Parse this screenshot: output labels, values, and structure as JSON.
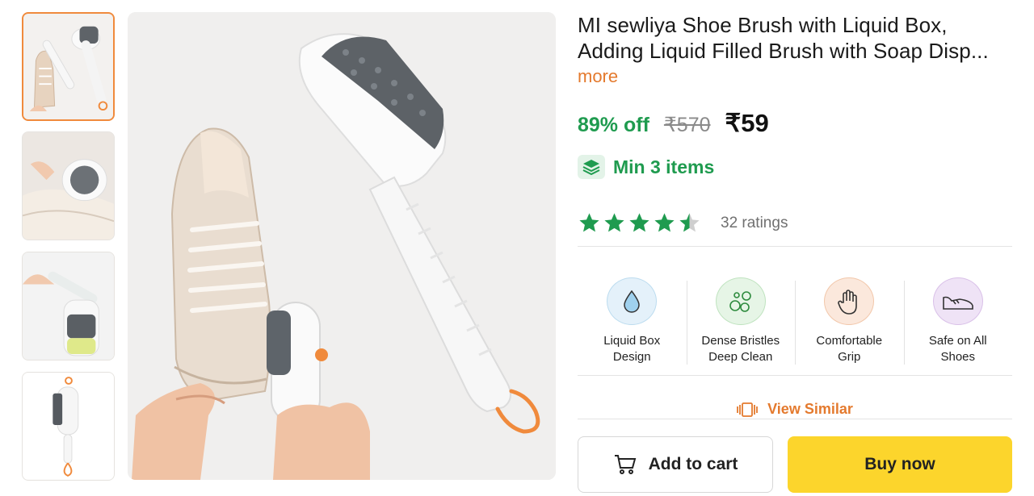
{
  "product": {
    "title_line1": "MI sewliya Shoe Brush with Liquid Box,",
    "title_line2": "Adding Liquid Filled Brush with Soap Disp...",
    "more_label": "more",
    "discount": "89% off",
    "mrp": "₹570",
    "price": "₹59",
    "min_items": "Min 3 items",
    "rating_stars": 4.5,
    "ratings_count": "32 ratings"
  },
  "thumbnails": [
    {
      "name": "thumb-shoe-and-brush",
      "active": true
    },
    {
      "name": "thumb-brush-cleaning-shoe",
      "active": false
    },
    {
      "name": "thumb-filling-liquid",
      "active": false
    },
    {
      "name": "thumb-brush-only",
      "active": false
    }
  ],
  "features": [
    {
      "line1": "Liquid Box",
      "line2": "Design",
      "icon": "droplet-icon",
      "bg": "#e4f1fa"
    },
    {
      "line1": "Dense Bristles",
      "line2": "Deep Clean",
      "icon": "bubbles-icon",
      "bg": "#e6f5e6"
    },
    {
      "line1": "Comfortable",
      "line2": "Grip",
      "icon": "hand-icon",
      "bg": "#fbe8dc"
    },
    {
      "line1": "Safe on All",
      "line2": "Shoes",
      "icon": "shoe-icon",
      "bg": "#efe3f6"
    }
  ],
  "actions": {
    "view_similar": "View Similar",
    "add_to_cart": "Add to cart",
    "buy_now": "Buy now"
  },
  "colors": {
    "accent_orange": "#e47a2e",
    "discount_green": "#1f9b4f",
    "buy_yellow": "#fcd52c",
    "star_green": "#1f9b4f"
  }
}
